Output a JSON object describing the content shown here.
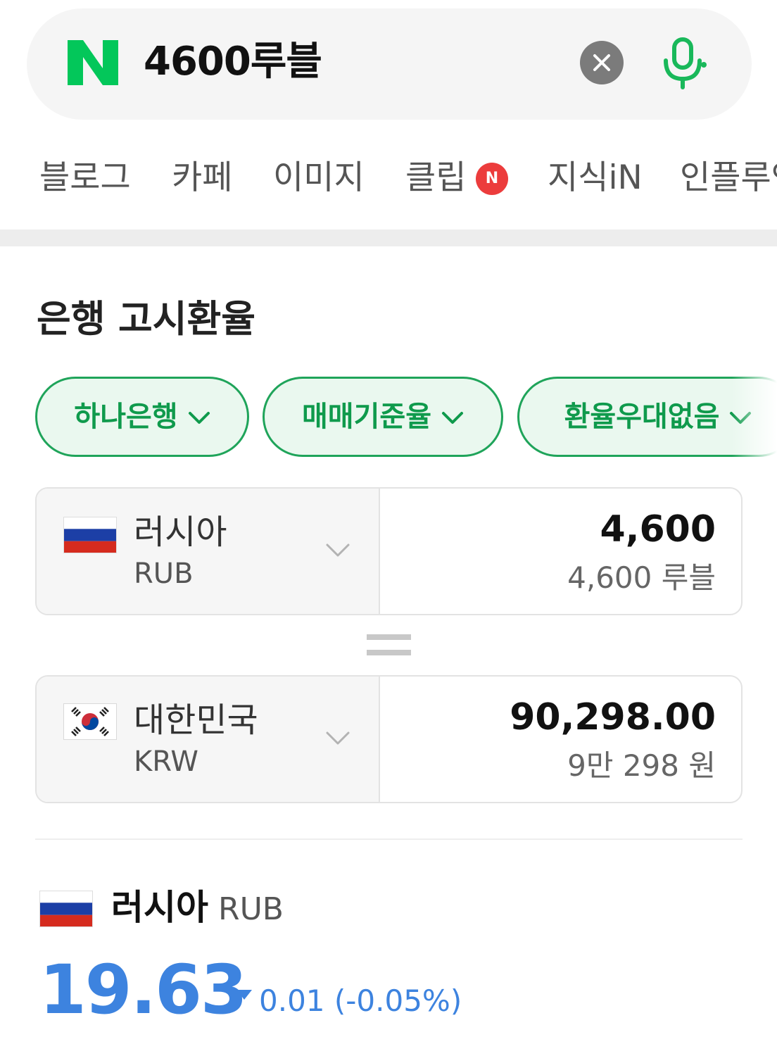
{
  "search": {
    "query": "4600루블"
  },
  "tabs": [
    {
      "label": "블로그"
    },
    {
      "label": "카페"
    },
    {
      "label": "이미지"
    },
    {
      "label": "클립",
      "badge": "N"
    },
    {
      "label": "지식iN"
    },
    {
      "label": "인플루언서"
    }
  ],
  "section": {
    "title": "은행 고시환율"
  },
  "filters": [
    {
      "label": "하나은행"
    },
    {
      "label": "매매기준율"
    },
    {
      "label": "환율우대없음"
    }
  ],
  "converter": {
    "from": {
      "country": "러시아",
      "code": "RUB",
      "amount": "4,600",
      "amount_korean": "4,600 루블"
    },
    "to": {
      "country": "대한민국",
      "code": "KRW",
      "amount": "90,298.00",
      "amount_korean": "9만 298 원"
    }
  },
  "rate": {
    "country": "러시아",
    "code": "RUB",
    "value": "19.63",
    "change": "0.01 (-0.05%)",
    "direction": "down"
  },
  "colors": {
    "naver_green": "#03c75a",
    "chip_green": "#0f9a4c",
    "rate_blue": "#3d83df",
    "badge_red": "#ec3c3c"
  }
}
